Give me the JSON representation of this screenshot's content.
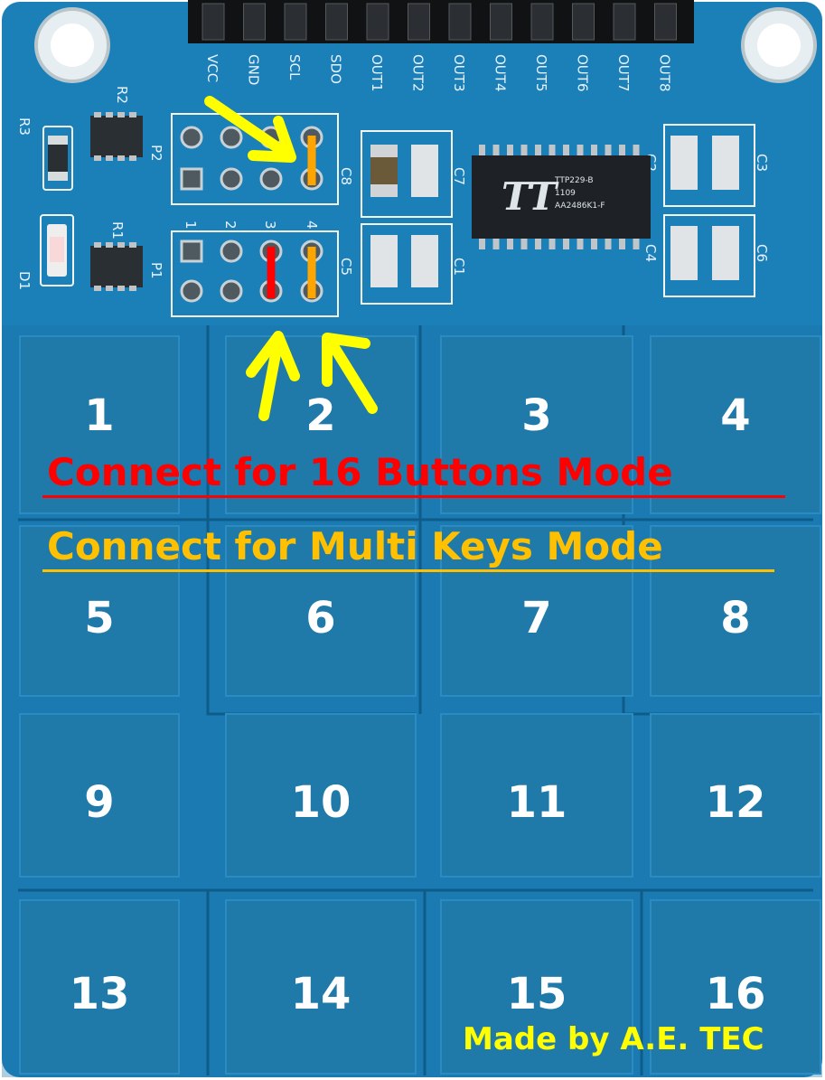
{
  "header_pins": [
    "VCC",
    "GND",
    "SCL",
    "SDO",
    "OUT1",
    "OUT2",
    "OUT3",
    "OUT4",
    "OUT5",
    "OUT6",
    "OUT7",
    "OUT8"
  ],
  "component_labels": {
    "r3": "R3",
    "r2": "R2",
    "r1": "R1",
    "p2": "P2",
    "p1": "P1",
    "d1": "D1",
    "c8": "C8",
    "c7": "C7",
    "c5": "C5",
    "c1": "C1",
    "c2": "C2",
    "c3": "C3",
    "c4": "C4",
    "c6": "C6",
    "jumper_numbers": [
      "1",
      "2",
      "3",
      "4"
    ]
  },
  "chip": {
    "logo": "TT",
    "line1": "TTP229-B",
    "line2": "1109",
    "line3": "AA2486K1-F"
  },
  "pads": [
    "1",
    "2",
    "3",
    "4",
    "5",
    "6",
    "7",
    "8",
    "9",
    "10",
    "11",
    "12",
    "13",
    "14",
    "15",
    "16"
  ],
  "captions": {
    "sixteen_buttons": "Connect for 16 Buttons Mode",
    "multi_keys": "Connect for Multi Keys Mode",
    "credit": "Made by A.E. TEC"
  },
  "colors": {
    "board": "#1c80b8",
    "pad": "#1f7aaa",
    "red_marker": "#ff0000",
    "orange_marker": "#ffa500",
    "yellow_arrow": "#ffff00"
  }
}
